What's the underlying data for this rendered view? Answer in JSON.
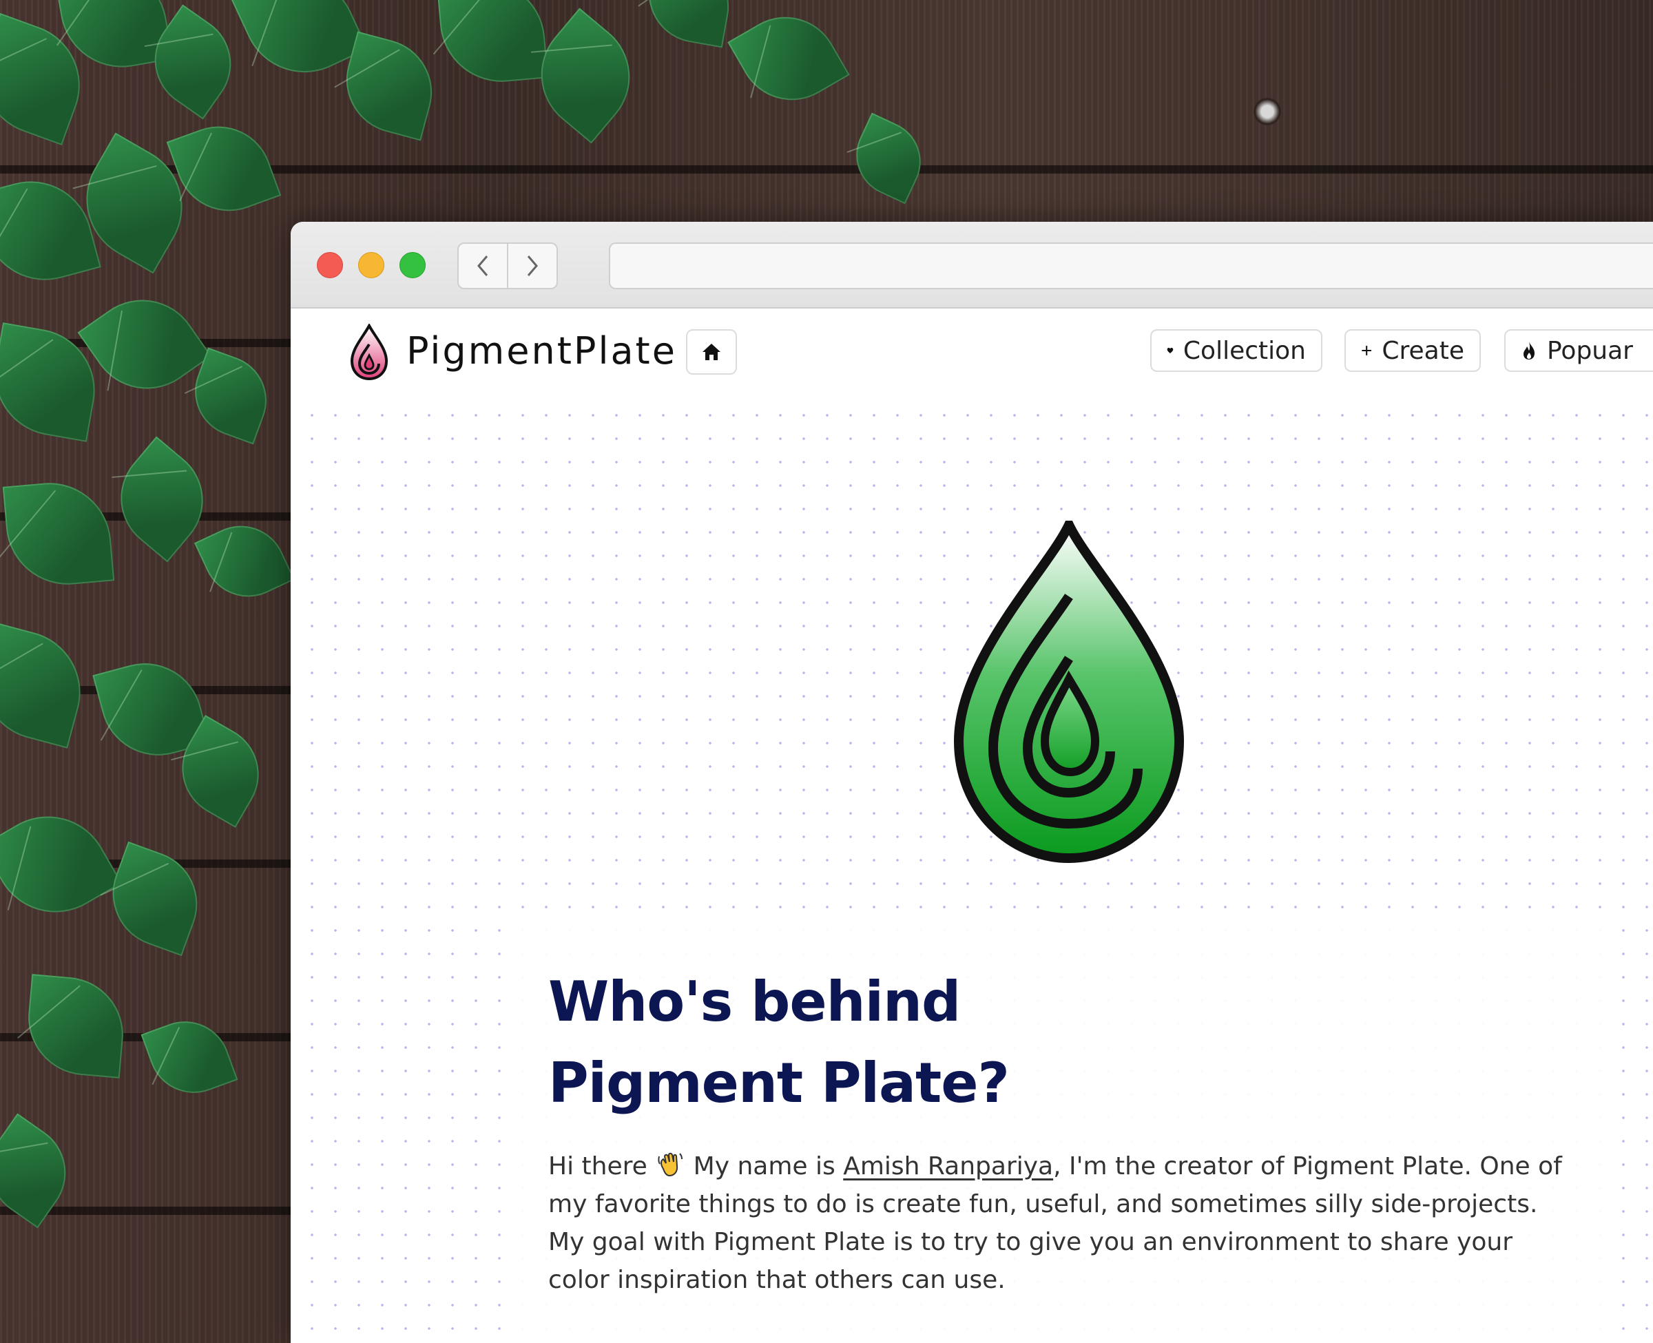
{
  "site": {
    "brand": "PigmentPlate",
    "nav": {
      "collection_label": "Collection",
      "create_label": "Create",
      "popular_label": "Popuar"
    }
  },
  "about": {
    "heading_line1": "Who's behind",
    "heading_line2": "Pigment Plate?",
    "para_before": "Hi there",
    "para_name_prefix": " My name is ",
    "author_name": "Amish Ranpariya",
    "para_after": ", I'm the creator of Pigment Plate. One of my favorite things to do is create fun, useful, and sometimes silly side-projects. My goal with Pigment Plate is to try to give you an environment to share your color inspiration that others can use."
  },
  "icons": {
    "logo": "droplet-logo-icon",
    "home": "home-icon",
    "heart": "heart-icon",
    "plus": "plus-icon",
    "fire": "fire-icon",
    "wave": "waving-hand-icon",
    "back": "chevron-left-icon",
    "forward": "chevron-right-icon"
  },
  "colors": {
    "heading": "#0c1652",
    "logo_green": "#1aa52a",
    "logo_pink": "#e0407a",
    "dot_grid": "#b9b4ee"
  }
}
